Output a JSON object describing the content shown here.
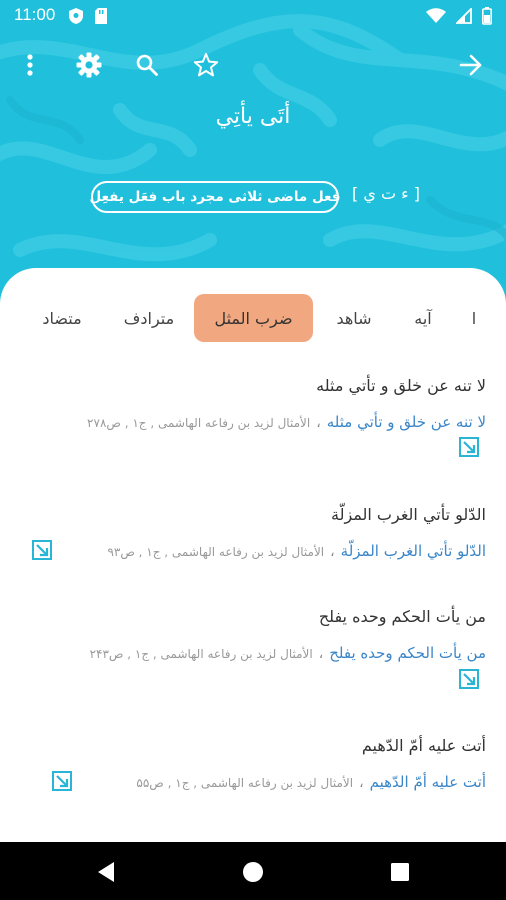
{
  "status_bar": {
    "time": "11:00",
    "icons": [
      "shield-icon",
      "sd-card-icon",
      "wifi-icon",
      "signal-icon",
      "battery-icon"
    ]
  },
  "toolbar": {
    "icons": [
      "more-vert-icon",
      "gear-icon",
      "search-icon",
      "star-icon",
      "arrow-right-icon"
    ]
  },
  "word": {
    "title": "أتَى يأتِي",
    "root": "[ ء ت ي ]",
    "verb_info": "فعل ماضى ثلاثى مجرد باب فعَل يفعِل"
  },
  "tabs": [
    {
      "label": "متضاد",
      "active": false
    },
    {
      "label": "مترادف",
      "active": false
    },
    {
      "label": "ضرب المثل",
      "active": true
    },
    {
      "label": "شاهد",
      "active": false
    },
    {
      "label": "آيه",
      "active": false
    },
    {
      "label": "ا",
      "active": false
    }
  ],
  "entries": [
    {
      "proverb": "لا تنه عن خلق و تأتي مثله",
      "link": "لا تنه عن خلق و تأتي مثله",
      "separator": "،",
      "source": "الأمثال لزيد بن رفاعه الهاشمى , ج۱ , ص۲۷۸"
    },
    {
      "proverb": "الدّلو تأتي الغرب المزلّة",
      "link": "الدّلو تأتي الغرب المزلّة",
      "separator": "،",
      "source": "الأمثال لزيد بن رفاعه الهاشمى , ج۱ , ص۹۳"
    },
    {
      "proverb": "من يأت الحكم وحده يفلح",
      "link": "من يأت الحكم وحده يفلح",
      "separator": "،",
      "source": "الأمثال لزيد بن رفاعه الهاشمى , ج۱ , ص۲۴۳"
    },
    {
      "proverb": "أتت عليه أمّ الدّهيم",
      "link": "أتت عليه أمّ الدّهيم",
      "separator": "،",
      "source": "الأمثال لزيد بن رفاعه الهاشمى , ج۱ , ص۵۵"
    }
  ],
  "colors": {
    "header": "#20c0dc",
    "active_tab": "#f1a77f",
    "link": "#3a86c8",
    "open_icon": "#29b5d6"
  },
  "nav_bar": {
    "icons": [
      "back-triangle-icon",
      "home-circle-icon",
      "recents-square-icon"
    ]
  }
}
